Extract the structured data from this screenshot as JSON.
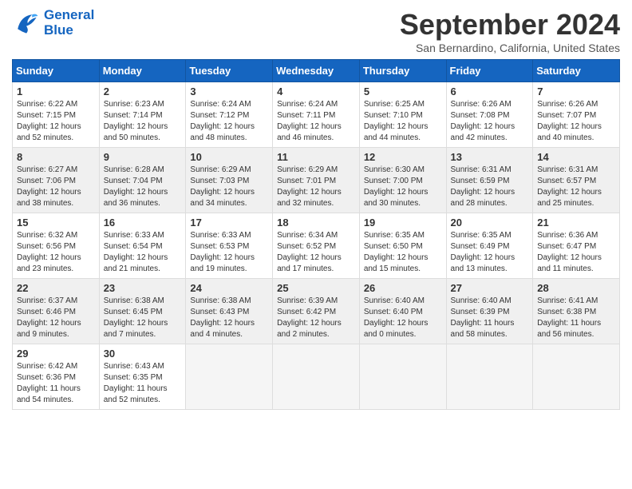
{
  "logo": {
    "line1": "General",
    "line2": "Blue"
  },
  "title": "September 2024",
  "subtitle": "San Bernardino, California, United States",
  "weekdays": [
    "Sunday",
    "Monday",
    "Tuesday",
    "Wednesday",
    "Thursday",
    "Friday",
    "Saturday"
  ],
  "weeks": [
    [
      {
        "day": "1",
        "sunrise": "6:22 AM",
        "sunset": "7:15 PM",
        "daylight": "12 hours and 52 minutes."
      },
      {
        "day": "2",
        "sunrise": "6:23 AM",
        "sunset": "7:14 PM",
        "daylight": "12 hours and 50 minutes."
      },
      {
        "day": "3",
        "sunrise": "6:24 AM",
        "sunset": "7:12 PM",
        "daylight": "12 hours and 48 minutes."
      },
      {
        "day": "4",
        "sunrise": "6:24 AM",
        "sunset": "7:11 PM",
        "daylight": "12 hours and 46 minutes."
      },
      {
        "day": "5",
        "sunrise": "6:25 AM",
        "sunset": "7:10 PM",
        "daylight": "12 hours and 44 minutes."
      },
      {
        "day": "6",
        "sunrise": "6:26 AM",
        "sunset": "7:08 PM",
        "daylight": "12 hours and 42 minutes."
      },
      {
        "day": "7",
        "sunrise": "6:26 AM",
        "sunset": "7:07 PM",
        "daylight": "12 hours and 40 minutes."
      }
    ],
    [
      {
        "day": "8",
        "sunrise": "6:27 AM",
        "sunset": "7:06 PM",
        "daylight": "12 hours and 38 minutes."
      },
      {
        "day": "9",
        "sunrise": "6:28 AM",
        "sunset": "7:04 PM",
        "daylight": "12 hours and 36 minutes."
      },
      {
        "day": "10",
        "sunrise": "6:29 AM",
        "sunset": "7:03 PM",
        "daylight": "12 hours and 34 minutes."
      },
      {
        "day": "11",
        "sunrise": "6:29 AM",
        "sunset": "7:01 PM",
        "daylight": "12 hours and 32 minutes."
      },
      {
        "day": "12",
        "sunrise": "6:30 AM",
        "sunset": "7:00 PM",
        "daylight": "12 hours and 30 minutes."
      },
      {
        "day": "13",
        "sunrise": "6:31 AM",
        "sunset": "6:59 PM",
        "daylight": "12 hours and 28 minutes."
      },
      {
        "day": "14",
        "sunrise": "6:31 AM",
        "sunset": "6:57 PM",
        "daylight": "12 hours and 25 minutes."
      }
    ],
    [
      {
        "day": "15",
        "sunrise": "6:32 AM",
        "sunset": "6:56 PM",
        "daylight": "12 hours and 23 minutes."
      },
      {
        "day": "16",
        "sunrise": "6:33 AM",
        "sunset": "6:54 PM",
        "daylight": "12 hours and 21 minutes."
      },
      {
        "day": "17",
        "sunrise": "6:33 AM",
        "sunset": "6:53 PM",
        "daylight": "12 hours and 19 minutes."
      },
      {
        "day": "18",
        "sunrise": "6:34 AM",
        "sunset": "6:52 PM",
        "daylight": "12 hours and 17 minutes."
      },
      {
        "day": "19",
        "sunrise": "6:35 AM",
        "sunset": "6:50 PM",
        "daylight": "12 hours and 15 minutes."
      },
      {
        "day": "20",
        "sunrise": "6:35 AM",
        "sunset": "6:49 PM",
        "daylight": "12 hours and 13 minutes."
      },
      {
        "day": "21",
        "sunrise": "6:36 AM",
        "sunset": "6:47 PM",
        "daylight": "12 hours and 11 minutes."
      }
    ],
    [
      {
        "day": "22",
        "sunrise": "6:37 AM",
        "sunset": "6:46 PM",
        "daylight": "12 hours and 9 minutes."
      },
      {
        "day": "23",
        "sunrise": "6:38 AM",
        "sunset": "6:45 PM",
        "daylight": "12 hours and 7 minutes."
      },
      {
        "day": "24",
        "sunrise": "6:38 AM",
        "sunset": "6:43 PM",
        "daylight": "12 hours and 4 minutes."
      },
      {
        "day": "25",
        "sunrise": "6:39 AM",
        "sunset": "6:42 PM",
        "daylight": "12 hours and 2 minutes."
      },
      {
        "day": "26",
        "sunrise": "6:40 AM",
        "sunset": "6:40 PM",
        "daylight": "12 hours and 0 minutes."
      },
      {
        "day": "27",
        "sunrise": "6:40 AM",
        "sunset": "6:39 PM",
        "daylight": "11 hours and 58 minutes."
      },
      {
        "day": "28",
        "sunrise": "6:41 AM",
        "sunset": "6:38 PM",
        "daylight": "11 hours and 56 minutes."
      }
    ],
    [
      {
        "day": "29",
        "sunrise": "6:42 AM",
        "sunset": "6:36 PM",
        "daylight": "11 hours and 54 minutes."
      },
      {
        "day": "30",
        "sunrise": "6:43 AM",
        "sunset": "6:35 PM",
        "daylight": "11 hours and 52 minutes."
      },
      null,
      null,
      null,
      null,
      null
    ]
  ]
}
